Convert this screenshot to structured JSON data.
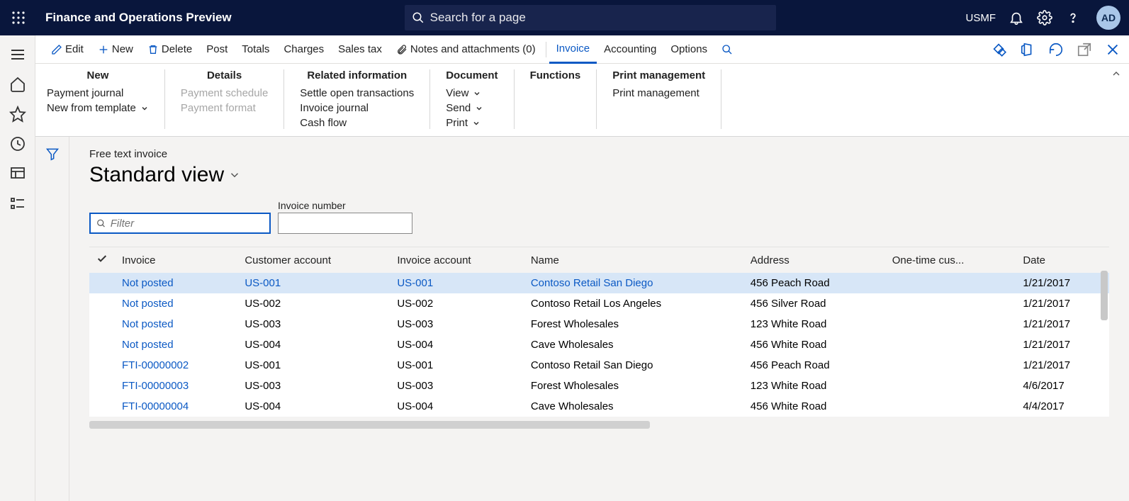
{
  "header": {
    "title": "Finance and Operations Preview",
    "search_placeholder": "Search for a page",
    "company": "USMF",
    "avatar": "AD"
  },
  "cmdbar": {
    "edit": "Edit",
    "new": "New",
    "delete": "Delete",
    "post": "Post",
    "totals": "Totals",
    "charges": "Charges",
    "salestax": "Sales tax",
    "notes": "Notes and attachments (0)",
    "invoice": "Invoice",
    "accounting": "Accounting",
    "options": "Options"
  },
  "ribbon": {
    "new": {
      "title": "New",
      "payment_journal": "Payment journal",
      "new_from_template": "New from template"
    },
    "details": {
      "title": "Details",
      "payment_schedule": "Payment schedule",
      "payment_format": "Payment format"
    },
    "related": {
      "title": "Related information",
      "settle": "Settle open transactions",
      "invoice_journal": "Invoice journal",
      "cash_flow": "Cash flow"
    },
    "document": {
      "title": "Document",
      "view": "View",
      "send": "Send",
      "print": "Print"
    },
    "functions": {
      "title": "Functions"
    },
    "printmgmt": {
      "title": "Print management",
      "item": "Print management"
    }
  },
  "content": {
    "breadcrumb": "Free text invoice",
    "view_name": "Standard view",
    "filter_placeholder": "Filter",
    "invoice_number_label": "Invoice number",
    "columns": {
      "invoice": "Invoice",
      "customer": "Customer account",
      "invoice_account": "Invoice account",
      "name": "Name",
      "address": "Address",
      "onetime": "One-time cus...",
      "date": "Date"
    },
    "rows": [
      {
        "invoice": "Not posted",
        "customer": "US-001",
        "invoice_account": "US-001",
        "name": "Contoso Retail San Diego",
        "address": "456 Peach Road",
        "date": "1/21/2017",
        "selected": true,
        "link_all": true
      },
      {
        "invoice": "Not posted",
        "customer": "US-002",
        "invoice_account": "US-002",
        "name": "Contoso Retail Los Angeles",
        "address": "456 Silver Road",
        "date": "1/21/2017"
      },
      {
        "invoice": "Not posted",
        "customer": "US-003",
        "invoice_account": "US-003",
        "name": "Forest Wholesales",
        "address": "123 White Road",
        "date": "1/21/2017"
      },
      {
        "invoice": "Not posted",
        "customer": "US-004",
        "invoice_account": "US-004",
        "name": "Cave Wholesales",
        "address": "456 White Road",
        "date": "1/21/2017"
      },
      {
        "invoice": "FTI-00000002",
        "customer": "US-001",
        "invoice_account": "US-001",
        "name": "Contoso Retail San Diego",
        "address": "456 Peach Road",
        "date": "1/21/2017"
      },
      {
        "invoice": "FTI-00000003",
        "customer": "US-003",
        "invoice_account": "US-003",
        "name": "Forest Wholesales",
        "address": "123 White Road",
        "date": "4/6/2017"
      },
      {
        "invoice": "FTI-00000004",
        "customer": "US-004",
        "invoice_account": "US-004",
        "name": "Cave Wholesales",
        "address": "456 White Road",
        "date": "4/4/2017"
      }
    ]
  }
}
